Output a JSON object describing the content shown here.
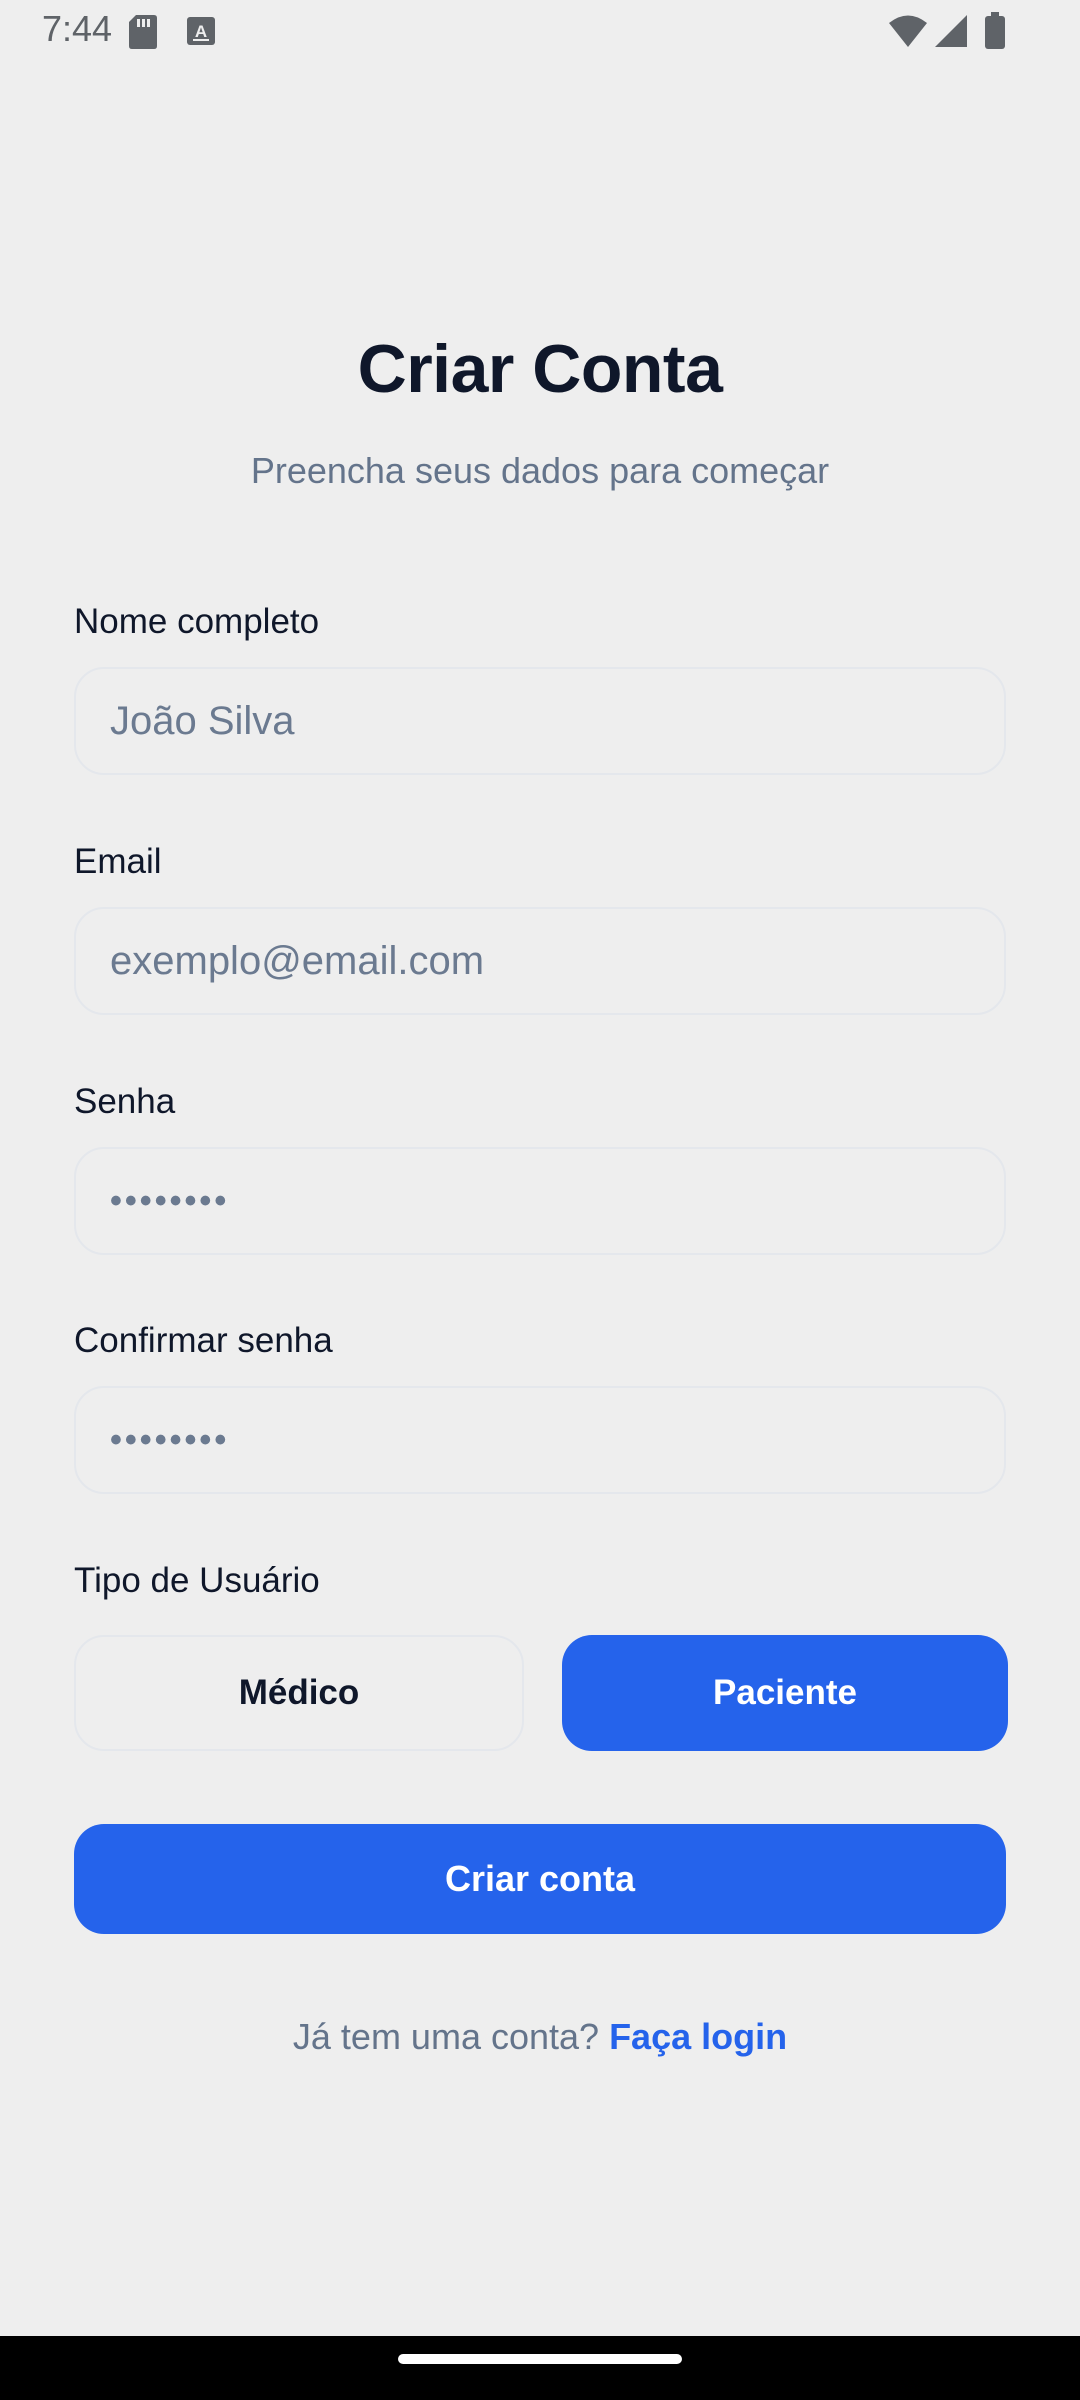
{
  "status_bar": {
    "time": "7:44",
    "left_icons": [
      "sd-card-icon",
      "keyboard-a-icon"
    ],
    "right_icons": [
      "wifi-icon",
      "cell-signal-icon",
      "battery-icon"
    ]
  },
  "header": {
    "title": "Criar Conta",
    "subtitle": "Preencha seus dados para começar"
  },
  "form": {
    "name": {
      "label": "Nome completo",
      "placeholder": "João Silva",
      "value": ""
    },
    "email": {
      "label": "Email",
      "placeholder": "exemplo@email.com",
      "value": ""
    },
    "password": {
      "label": "Senha",
      "masked_placeholder": "••••••••"
    },
    "confirm_password": {
      "label": "Confirmar senha",
      "masked_placeholder": "••••••••"
    },
    "user_type": {
      "label": "Tipo de Usuário",
      "options": [
        "Médico",
        "Paciente"
      ],
      "selected": "Paciente"
    },
    "submit_label": "Criar conta"
  },
  "footer": {
    "prompt": "Já tem uma conta?",
    "link_label": "Faça login"
  },
  "colors": {
    "background": "#eeeeee",
    "accent": "#2563eb",
    "title": "#0f172a",
    "muted": "#64748b",
    "border": "#e4e7ec"
  }
}
